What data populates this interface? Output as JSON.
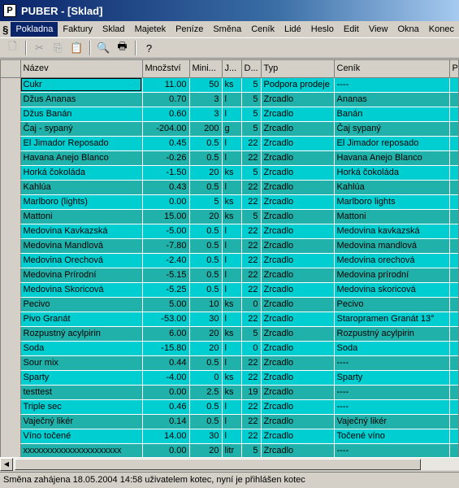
{
  "window": {
    "title": "PUBER - [Sklad]"
  },
  "menu": [
    "Pokladna",
    "Faktury",
    "Sklad",
    "Majetek",
    "Peníze",
    "Směna",
    "Ceník",
    "Lidé",
    "Heslo",
    "Edit",
    "View",
    "Okna",
    "Konec"
  ],
  "toolbar": {
    "buttons": [
      {
        "name": "new-icon",
        "glyph": "🗋",
        "enabled": false
      },
      {
        "name": "cut-icon",
        "glyph": "✂",
        "enabled": false
      },
      {
        "name": "copy-icon",
        "glyph": "⎘",
        "enabled": false
      },
      {
        "name": "paste-icon",
        "glyph": "📋",
        "enabled": false
      },
      {
        "name": "find-icon",
        "glyph": "🔍",
        "enabled": true
      },
      {
        "name": "print-icon",
        "glyph": "🖶",
        "enabled": true
      },
      {
        "name": "help-icon",
        "glyph": "?",
        "enabled": true
      }
    ]
  },
  "grid": {
    "columns": [
      "Název",
      "Množství",
      "Mini...",
      "J...",
      "D...",
      "Typ",
      "Ceník",
      "P"
    ],
    "rows": [
      {
        "name": "Cukr",
        "qty": "11.00",
        "min": "50",
        "unit": "ks",
        "d": "5",
        "type": "Podpora prodeje",
        "price": "----"
      },
      {
        "name": "Džus Ananas",
        "qty": "0.70",
        "min": "3",
        "unit": "l",
        "d": "5",
        "type": "Zrcadlo",
        "price": "Ananas"
      },
      {
        "name": "Džus Banán",
        "qty": "0.60",
        "min": "3",
        "unit": "l",
        "d": "5",
        "type": "Zrcadlo",
        "price": "Banán"
      },
      {
        "name": "Čaj - sypaný",
        "qty": "-204.00",
        "min": "200",
        "unit": "g",
        "d": "5",
        "type": "Zrcadlo",
        "price": "Čaj sypaný"
      },
      {
        "name": "El Jimador Reposado",
        "qty": "0.45",
        "min": "0.5",
        "unit": "l",
        "d": "22",
        "type": "Zrcadlo",
        "price": "El Jimador reposado"
      },
      {
        "name": "Havana Anejo Blanco",
        "qty": "-0.26",
        "min": "0.5",
        "unit": "l",
        "d": "22",
        "type": "Zrcadlo",
        "price": "Havana Anejo Blanco"
      },
      {
        "name": "Horká čokoláda",
        "qty": "-1.50",
        "min": "20",
        "unit": "ks",
        "d": "5",
        "type": "Zrcadlo",
        "price": "Horká čokoláda"
      },
      {
        "name": "Kahlúa",
        "qty": "0.43",
        "min": "0.5",
        "unit": "l",
        "d": "22",
        "type": "Zrcadlo",
        "price": "Kahlúa"
      },
      {
        "name": "Marlboro (lights)",
        "qty": "0.00",
        "min": "5",
        "unit": "ks",
        "d": "22",
        "type": "Zrcadlo",
        "price": "Marlboro lights"
      },
      {
        "name": "Mattoni",
        "qty": "15.00",
        "min": "20",
        "unit": "ks",
        "d": "5",
        "type": "Zrcadlo",
        "price": "Mattoni"
      },
      {
        "name": "Medovina Kavkazská",
        "qty": "-5.00",
        "min": "0.5",
        "unit": "l",
        "d": "22",
        "type": "Zrcadlo",
        "price": "Medovina kavkazská"
      },
      {
        "name": "Medovina Mandlová",
        "qty": "-7.80",
        "min": "0.5",
        "unit": "l",
        "d": "22",
        "type": "Zrcadlo",
        "price": "Medovina mandlová"
      },
      {
        "name": "Medovina Orechová",
        "qty": "-2.40",
        "min": "0.5",
        "unit": "l",
        "d": "22",
        "type": "Zrcadlo",
        "price": "Medovina orechová"
      },
      {
        "name": "Medovina Prírodní",
        "qty": "-5.15",
        "min": "0.5",
        "unit": "l",
        "d": "22",
        "type": "Zrcadlo",
        "price": "Medovina prírodní"
      },
      {
        "name": "Medovina Skoricová",
        "qty": "-5.25",
        "min": "0.5",
        "unit": "l",
        "d": "22",
        "type": "Zrcadlo",
        "price": "Medovina skoricová"
      },
      {
        "name": "Pecivo",
        "qty": "5.00",
        "min": "10",
        "unit": "ks",
        "d": "0",
        "type": "Zrcadlo",
        "price": "Pecivo"
      },
      {
        "name": "Pivo Granát",
        "qty": "-53.00",
        "min": "30",
        "unit": "l",
        "d": "22",
        "type": "Zrcadlo",
        "price": "Staropramen Granát 13°"
      },
      {
        "name": "Rozpustný acylpirin",
        "qty": "6.00",
        "min": "20",
        "unit": "ks",
        "d": "5",
        "type": "Zrcadlo",
        "price": "Rozpustný acylpirin"
      },
      {
        "name": "Soda",
        "qty": "-15.80",
        "min": "20",
        "unit": "l",
        "d": "0",
        "type": "Zrcadlo",
        "price": "Soda"
      },
      {
        "name": "Sour mix",
        "qty": "0.44",
        "min": "0.5",
        "unit": "l",
        "d": "22",
        "type": "Zrcadlo",
        "price": "----"
      },
      {
        "name": "Sparty",
        "qty": "-4.00",
        "min": "0",
        "unit": "ks",
        "d": "22",
        "type": "Zrcadlo",
        "price": "Sparty"
      },
      {
        "name": "testtest",
        "qty": "0.00",
        "min": "2.5",
        "unit": "ks",
        "d": "19",
        "type": "Zrcadlo",
        "price": "----"
      },
      {
        "name": "Triple sec",
        "qty": "0.46",
        "min": "0.5",
        "unit": "l",
        "d": "22",
        "type": "Zrcadlo",
        "price": "----"
      },
      {
        "name": "Vaječný likér",
        "qty": "0.14",
        "min": "0.5",
        "unit": "l",
        "d": "22",
        "type": "Zrcadlo",
        "price": "Vaječný likér"
      },
      {
        "name": "Víno točené",
        "qty": "14.00",
        "min": "30",
        "unit": "l",
        "d": "22",
        "type": "Zrcadlo",
        "price": "Točené víno"
      },
      {
        "name": "xxxxxxxxxxxxxxxxxxxxxx",
        "qty": "0.00",
        "min": "20",
        "unit": "litr",
        "d": "5",
        "type": "Zrcadlo",
        "price": "----"
      }
    ]
  },
  "status": {
    "text": "Směna zahájena 18.05.2004 14:58 uživatelem kotec, nyní je přihlášen kotec"
  },
  "colors": {
    "row_light": "#00ced1",
    "row_dark": "#20b2aa",
    "title_bar": "#0a246a",
    "chrome": "#d4d0c8"
  }
}
